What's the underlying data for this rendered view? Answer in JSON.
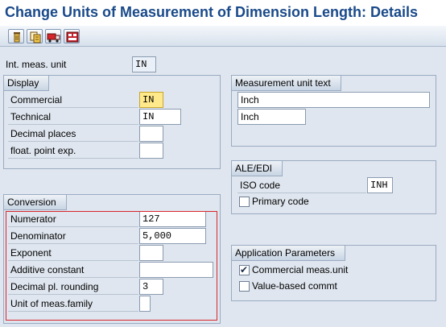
{
  "window": {
    "title": "Change Units of Measurement of Dimension Length: Details"
  },
  "toolbar": {
    "buttons": [
      {
        "icon": "trash-icon"
      },
      {
        "icon": "copy-icon"
      },
      {
        "icon": "truck-icon"
      },
      {
        "icon": "sql-icon"
      }
    ]
  },
  "header": {
    "int_meas_unit_label": "Int. meas. unit",
    "int_meas_unit_value": "IN"
  },
  "display": {
    "title": "Display",
    "commercial_label": "Commercial",
    "commercial_value": "IN",
    "technical_label": "Technical",
    "technical_value": "IN",
    "decimal_places_label": "Decimal places",
    "decimal_places_value": "",
    "float_point_label": "float. point exp.",
    "float_point_value": ""
  },
  "measurement_text": {
    "title": "Measurement unit text",
    "long_text": "Inch",
    "short_text": "Inch"
  },
  "ale_edi": {
    "title": "ALE/EDI",
    "iso_code_label": "ISO code",
    "iso_code_value": "INH",
    "primary_code_label": "Primary code",
    "primary_code_checked": false
  },
  "conversion": {
    "title": "Conversion",
    "numerator_label": "Numerator",
    "numerator_value": "127",
    "denominator_label": "Denominator",
    "denominator_value": "5,000",
    "exponent_label": "Exponent",
    "exponent_value": "",
    "additive_constant_label": "Additive constant",
    "additive_constant_value": "",
    "decimal_rounding_label": "Decimal pl. rounding",
    "decimal_rounding_value": "3",
    "unit_family_label": "Unit of meas.family",
    "unit_family_value": ""
  },
  "application_params": {
    "title": "Application Parameters",
    "commercial_label": "Commercial meas.unit",
    "commercial_checked": true,
    "commercial_check_glyph": "✔",
    "value_based_label": "Value-based commt",
    "value_based_checked": false
  },
  "colors": {
    "title": "#1a4a8a",
    "background": "#dfe6ef",
    "highlight_border": "#d7262b",
    "active_field": "#ffe98a"
  }
}
